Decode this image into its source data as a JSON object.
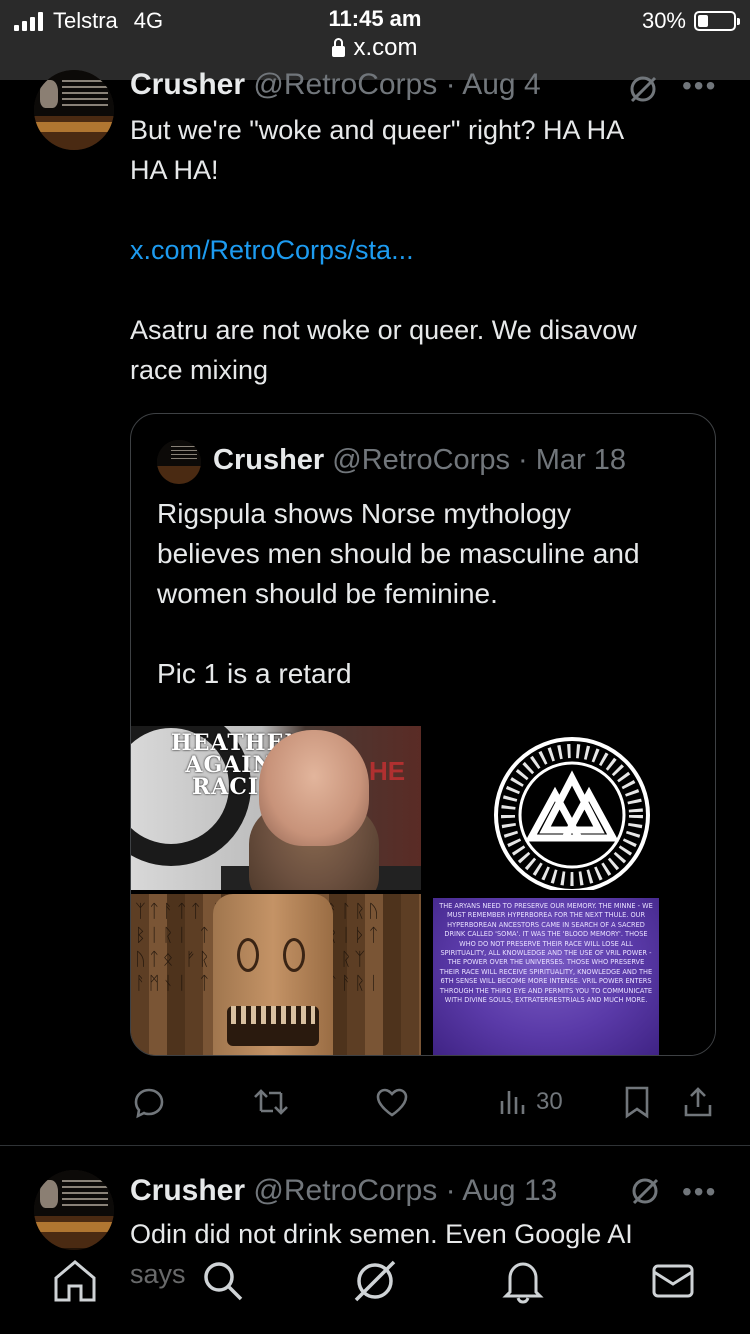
{
  "status_bar": {
    "carrier": "Telstra",
    "network": "4G",
    "time": "11:45 am",
    "url": "x.com",
    "battery_text": "30%",
    "battery_level": 0.3
  },
  "tweet1": {
    "name": "Crusher",
    "meta": "@RetroCorps · Aug 4",
    "text_line1": "But we're \"woke and queer\" right? HA HA",
    "text_line2": "HA HA!",
    "link": "x.com/RetroCorps/sta...",
    "text_line3": "Asatru are not woke or queer. We disavow",
    "text_line4": "race mixing"
  },
  "quote": {
    "name": "Crusher",
    "meta": "@RetroCorps · Mar 18",
    "lines": [
      "Rigspula shows Norse mythology",
      "believes men should be masculine and",
      "women should be feminine.",
      "",
      "Pic 1 is a retard"
    ],
    "media": {
      "img1_text": [
        "HEATHENS",
        "AGAINST",
        "RACISM"
      ],
      "img1_side": "HE",
      "img4_text": "The Aryans need to preserve our memory. The minne - we must remember Hyperborea for the next Thule. Our Hyperborean ancestors came in search of a sacred drink called 'Soma'. It was the 'blood memory'. Those who do not preserve their race will lose all spirituality, all knowledge and the use of Vril Power - the power over the universes. Those who preserve their race will receive spirituality, knowledge and the 6th sense will become more intense. Vril power enters through the third eye and permits you to communicate with divine souls, extraterrestrials and much more."
    }
  },
  "actions": {
    "views": "30"
  },
  "tweet2": {
    "name": "Crusher",
    "meta": "@RetroCorps · Aug 13",
    "text_line1": "Odin did not drink semen. Even Google AI",
    "text_line2": "says"
  },
  "colors": {
    "background": "#000000",
    "text": "#e7e9ea",
    "muted": "#71767b",
    "link": "#1d9bf0",
    "border": "#2f3336"
  }
}
